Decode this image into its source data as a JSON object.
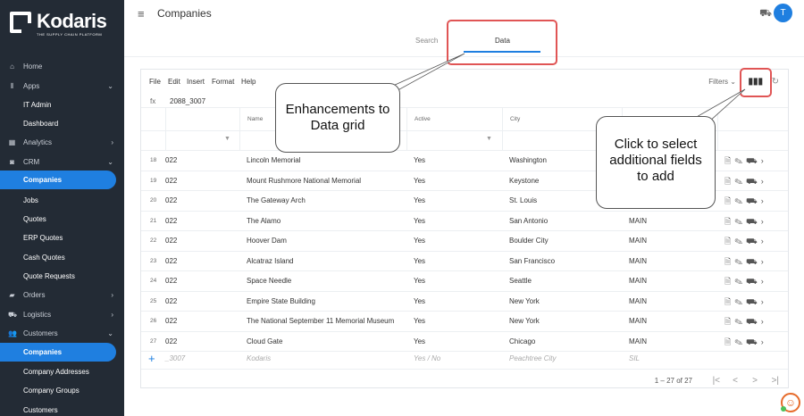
{
  "brand": {
    "name": "Kodaris",
    "tagline": "THE SUPPLY CHAIN PLATFORM"
  },
  "sidebar": {
    "items": [
      {
        "label": "Home",
        "icon": "home-icon",
        "glyph": "⌂",
        "caret": "",
        "sub": false,
        "active": false
      },
      {
        "label": "Apps",
        "icon": "apps-icon",
        "glyph": "⦀",
        "caret": "⌄",
        "sub": false,
        "active": false
      },
      {
        "label": "IT Admin",
        "icon": "",
        "glyph": "",
        "caret": "",
        "sub": true,
        "active": false
      },
      {
        "label": "Dashboard",
        "icon": "",
        "glyph": "",
        "caret": "",
        "sub": true,
        "active": false
      },
      {
        "label": "Analytics",
        "icon": "analytics-icon",
        "glyph": "▦",
        "caret": "›",
        "sub": false,
        "active": false
      },
      {
        "label": "CRM",
        "icon": "crm-icon",
        "glyph": "◙",
        "caret": "⌄",
        "sub": false,
        "active": false
      },
      {
        "label": "Companies",
        "icon": "",
        "glyph": "",
        "caret": "",
        "sub": true,
        "active": true
      },
      {
        "label": "Jobs",
        "icon": "",
        "glyph": "",
        "caret": "",
        "sub": true,
        "active": false
      },
      {
        "label": "Quotes",
        "icon": "",
        "glyph": "",
        "caret": "",
        "sub": true,
        "active": false
      },
      {
        "label": "ERP Quotes",
        "icon": "",
        "glyph": "",
        "caret": "",
        "sub": true,
        "active": false
      },
      {
        "label": "Cash Quotes",
        "icon": "",
        "glyph": "",
        "caret": "",
        "sub": true,
        "active": false
      },
      {
        "label": "Quote Requests",
        "icon": "",
        "glyph": "",
        "caret": "",
        "sub": true,
        "active": false
      },
      {
        "label": "Orders",
        "icon": "orders-icon",
        "glyph": "▰",
        "caret": "›",
        "sub": false,
        "active": false
      },
      {
        "label": "Logistics",
        "icon": "logistics-icon",
        "glyph": "⛟",
        "caret": "›",
        "sub": false,
        "active": false
      },
      {
        "label": "Customers",
        "icon": "customers-icon",
        "glyph": "👥",
        "caret": "⌄",
        "sub": false,
        "active": false
      },
      {
        "label": "Companies",
        "icon": "",
        "glyph": "",
        "caret": "",
        "sub": true,
        "active": true
      },
      {
        "label": "Company Addresses",
        "icon": "",
        "glyph": "",
        "caret": "",
        "sub": true,
        "active": false
      },
      {
        "label": "Company Groups",
        "icon": "",
        "glyph": "",
        "caret": "",
        "sub": true,
        "active": false
      },
      {
        "label": "Customers",
        "icon": "",
        "glyph": "",
        "caret": "",
        "sub": true,
        "active": false
      }
    ]
  },
  "header": {
    "title": "Companies",
    "avatar_initial": "T",
    "tabs": [
      {
        "label": "Search"
      },
      {
        "label": "Data"
      }
    ]
  },
  "grid": {
    "menu": [
      "File",
      "Edit",
      "Insert",
      "Format",
      "Help"
    ],
    "filters_label": "Filters",
    "fx_label": "fx",
    "fx_value": "2088_3007",
    "columns": [
      "Name",
      "Active",
      "City"
    ],
    "rows": [
      {
        "n": "18",
        "c0": "022",
        "name": "Lincoln Memorial",
        "active": "Yes",
        "city": "Washington",
        "extra": ""
      },
      {
        "n": "19",
        "c0": "022",
        "name": "Mount Rushmore National Memorial",
        "active": "Yes",
        "city": "Keystone",
        "extra": ""
      },
      {
        "n": "20",
        "c0": "022",
        "name": "The Gateway Arch",
        "active": "Yes",
        "city": "St. Louis",
        "extra": ""
      },
      {
        "n": "21",
        "c0": "022",
        "name": "The Alamo",
        "active": "Yes",
        "city": "San Antonio",
        "extra": "MAIN"
      },
      {
        "n": "22",
        "c0": "022",
        "name": "Hoover Dam",
        "active": "Yes",
        "city": "Boulder City",
        "extra": "MAIN"
      },
      {
        "n": "23",
        "c0": "022",
        "name": "Alcatraz Island",
        "active": "Yes",
        "city": "San Francisco",
        "extra": "MAIN"
      },
      {
        "n": "24",
        "c0": "022",
        "name": "Space Needle",
        "active": "Yes",
        "city": "Seattle",
        "extra": "MAIN"
      },
      {
        "n": "25",
        "c0": "022",
        "name": "Empire State Building",
        "active": "Yes",
        "city": "New York",
        "extra": "MAIN"
      },
      {
        "n": "26",
        "c0": "022",
        "name": "The National September 11 Memorial Museum",
        "active": "Yes",
        "city": "New York",
        "extra": "MAIN"
      },
      {
        "n": "27",
        "c0": "022",
        "name": "Cloud Gate",
        "active": "Yes",
        "city": "Chicago",
        "extra": "MAIN"
      }
    ],
    "new_row": {
      "c0": "_3007",
      "name": "Kodaris",
      "active": "Yes / No",
      "city": "Peachtree City",
      "extra": "SIL"
    },
    "pagination": "1 – 27 of 27"
  },
  "callouts": {
    "grid": "Enhancements to Data grid",
    "fields": "Click to select additional fields to add"
  },
  "colors": {
    "sidebar_bg": "#232b35",
    "accent": "#1f7fe0",
    "highlight": "#e05555"
  }
}
